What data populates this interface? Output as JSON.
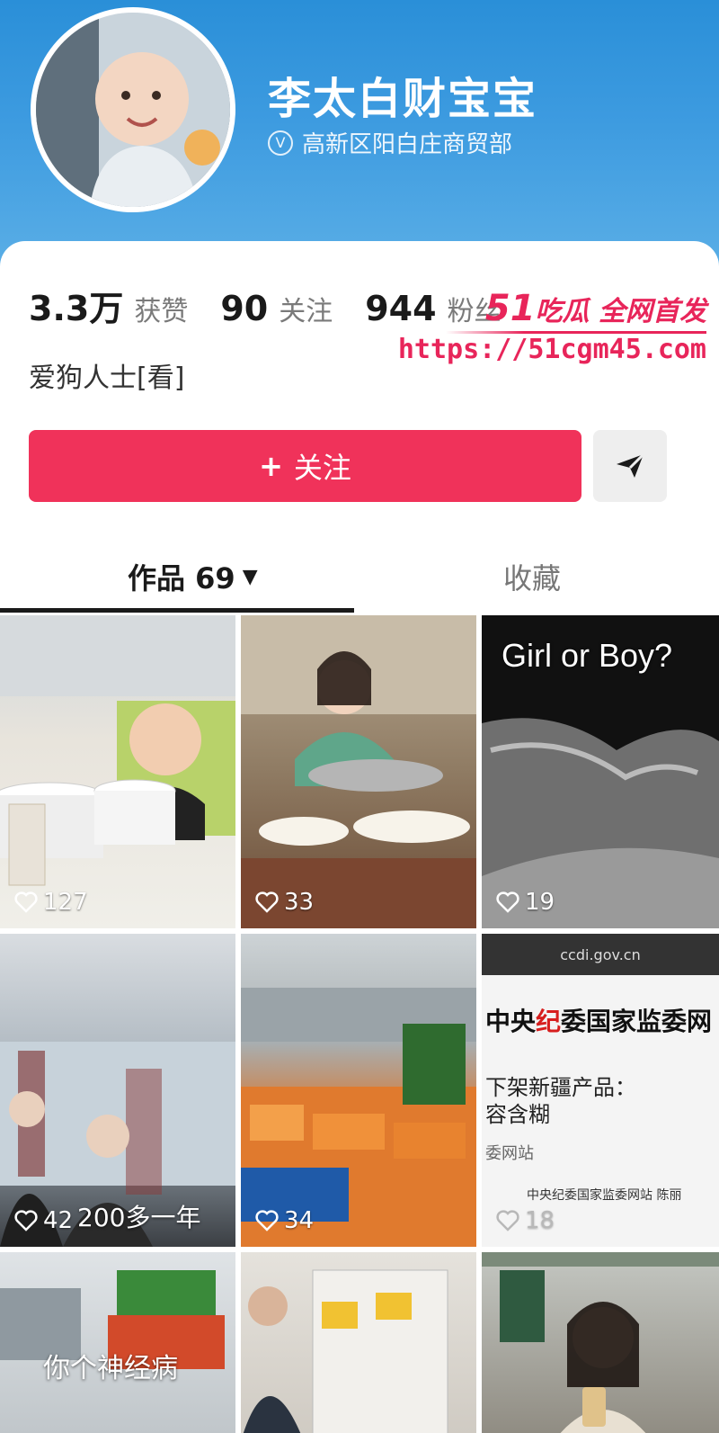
{
  "profile": {
    "name": "李太白财宝宝",
    "verified_label": "高新区阳白庄商贸部",
    "stats": [
      {
        "value": "3.3万",
        "label": "获赞"
      },
      {
        "value": "90",
        "label": "关注"
      },
      {
        "value": "944",
        "label": "粉丝"
      }
    ],
    "bio": "爱狗人士[看]"
  },
  "watermark": {
    "brand_num": "51",
    "brand_text": "吃瓜 全网首发",
    "url": "https://51cgm45.com"
  },
  "actions": {
    "follow_plus": "+",
    "follow_label": "关注"
  },
  "tabs": {
    "works_label": "作品 69",
    "favorites_label": "收藏"
  },
  "videos": [
    {
      "likes": "127",
      "overlay": ""
    },
    {
      "likes": "33",
      "overlay": ""
    },
    {
      "likes": "19",
      "overlay": "Girl or Boy?"
    },
    {
      "likes": "42",
      "overlay": "200多一年"
    },
    {
      "likes": "34",
      "overlay": ""
    },
    {
      "likes": "18",
      "overlay": ""
    },
    {
      "likes": "",
      "overlay": "你个神经病"
    },
    {
      "likes": "",
      "overlay": ""
    },
    {
      "likes": "",
      "overlay": ""
    }
  ],
  "news_thumb": {
    "site": "ccdi.gov.cn",
    "headline_red": "纪",
    "headline_pre": "中央",
    "headline_post": "委国家监委网",
    "body_line1": "下架新疆产品：",
    "body_line2": "容含糊",
    "source": "委网站",
    "credit": "中央纪委国家监委网站 陈丽"
  },
  "colors": {
    "header_blue": "#2a8fd8",
    "follow_red": "#f0325a",
    "watermark_pink": "#e8255a"
  }
}
